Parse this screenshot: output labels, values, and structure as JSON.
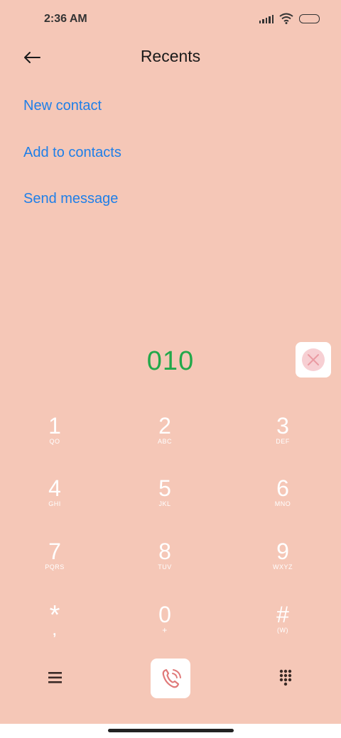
{
  "status_bar": {
    "time": "2:36 AM"
  },
  "header": {
    "title": "Recents"
  },
  "actions": [
    {
      "label": "New contact"
    },
    {
      "label": "Add to contacts"
    },
    {
      "label": "Send message"
    }
  ],
  "dialed_number": "010",
  "keypad": [
    {
      "digit": "1",
      "letters": "QO"
    },
    {
      "digit": "2",
      "letters": "ABC"
    },
    {
      "digit": "3",
      "letters": "DEF"
    },
    {
      "digit": "4",
      "letters": "GHI"
    },
    {
      "digit": "5",
      "letters": "JKL"
    },
    {
      "digit": "6",
      "letters": "MNO"
    },
    {
      "digit": "7",
      "letters": "PQRS"
    },
    {
      "digit": "8",
      "letters": "TUV"
    },
    {
      "digit": "9",
      "letters": "WXYZ"
    },
    {
      "digit": "*",
      "letters": ","
    },
    {
      "digit": "0",
      "letters": "+"
    },
    {
      "digit": "#",
      "letters": "(W)"
    }
  ],
  "colors": {
    "background": "#f5c7b7",
    "link": "#1f7fe8",
    "number": "#22a84a",
    "call_icon": "#e07a7a"
  },
  "icons": {
    "back": "arrow-left-icon",
    "delete": "close-circle-icon",
    "menu": "menu-icon",
    "call": "phone-icon",
    "dialpad": "dialpad-icon"
  }
}
